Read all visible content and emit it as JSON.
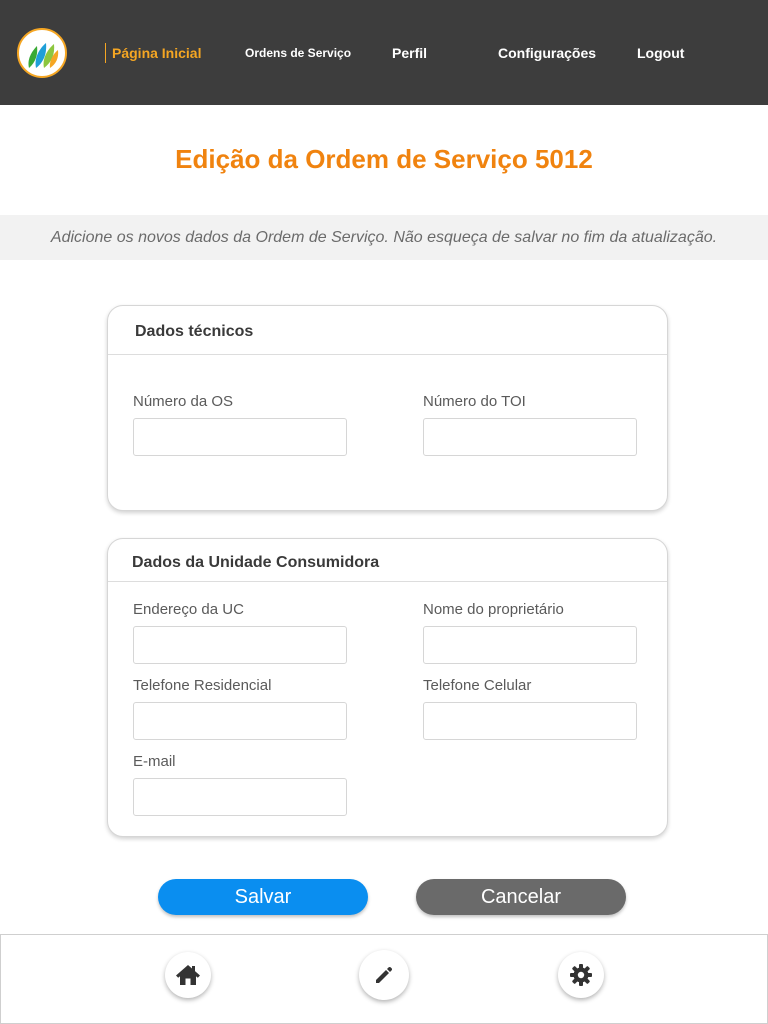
{
  "nav": {
    "home": "Página Inicial",
    "orders": "Ordens de Serviço",
    "profile": "Perfil",
    "settings": "Configurações",
    "logout": "Logout"
  },
  "page": {
    "title": "Edição da Ordem de Serviço 5012",
    "subtitle": "Adicione os novos dados da Ordem de Serviço. Não esqueça de salvar no fim da atualização."
  },
  "technical": {
    "title": "Dados técnicos",
    "os_number_label": "Número da OS",
    "os_number_value": "",
    "toi_number_label": "Número do TOI",
    "toi_number_value": ""
  },
  "consumer_unit": {
    "title": "Dados da Unidade Consumidora",
    "address_label": "Endereço da UC",
    "address_value": "",
    "owner_label": "Nome do proprietário",
    "owner_value": "",
    "home_phone_label": "Telefone Residencial",
    "home_phone_value": "",
    "mobile_phone_label": "Telefone Celular",
    "mobile_phone_value": "",
    "email_label": "E-mail",
    "email_value": ""
  },
  "actions": {
    "save": "Salvar",
    "cancel": "Cancelar"
  },
  "tabbar": {
    "items": [
      {
        "icon": "home-icon"
      },
      {
        "icon": "pencil-icon"
      },
      {
        "icon": "gear-icon"
      }
    ]
  },
  "colors": {
    "accent": "#f0830f",
    "nav_background": "#3d3d3d",
    "primary_button": "#0a8ef0",
    "secondary_button": "#6a6a6a"
  }
}
